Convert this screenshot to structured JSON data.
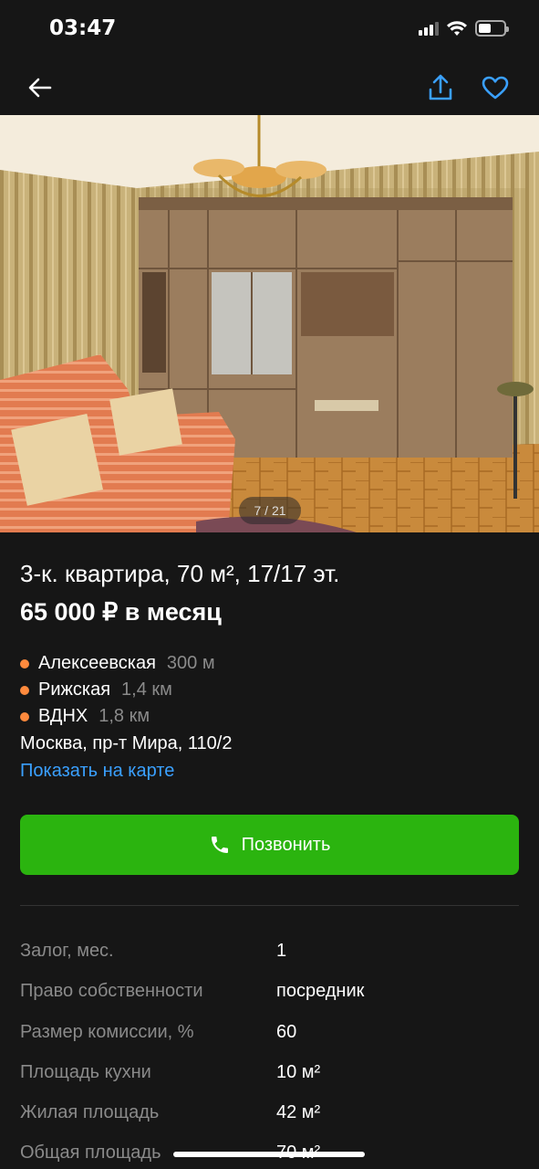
{
  "status": {
    "time": "03:47"
  },
  "nav": {
    "back": "back-icon",
    "share": "share-icon",
    "favorite": "heart-icon"
  },
  "photo": {
    "counter": "7 / 21"
  },
  "listing": {
    "title": "3-к. квартира, 70 м², 17/17 эт.",
    "price": "65 000 ₽ в месяц",
    "metro": [
      {
        "station": "Алексеевская",
        "distance": "300 м"
      },
      {
        "station": "Рижская",
        "distance": "1,4 км"
      },
      {
        "station": "ВДНХ",
        "distance": "1,8 км"
      }
    ],
    "address": "Москва, пр-т Мира, 110/2",
    "map_link": "Показать на карте",
    "call_label": "Позвонить"
  },
  "params": [
    {
      "key": "Залог, мес.",
      "value": "1"
    },
    {
      "key": "Право собственности",
      "value": "посредник"
    },
    {
      "key": "Размер комиссии, %",
      "value": "60"
    },
    {
      "key": "Площадь кухни",
      "value": "10 м²"
    },
    {
      "key": "Жилая площадь",
      "value": "42 м²"
    },
    {
      "key": "Общая площадь",
      "value": "70 м²"
    }
  ],
  "colors": {
    "accent_green": "#2bb40f",
    "link_blue": "#3aa0ff",
    "metro_dot": "#ff8a3d",
    "background": "#161616"
  }
}
